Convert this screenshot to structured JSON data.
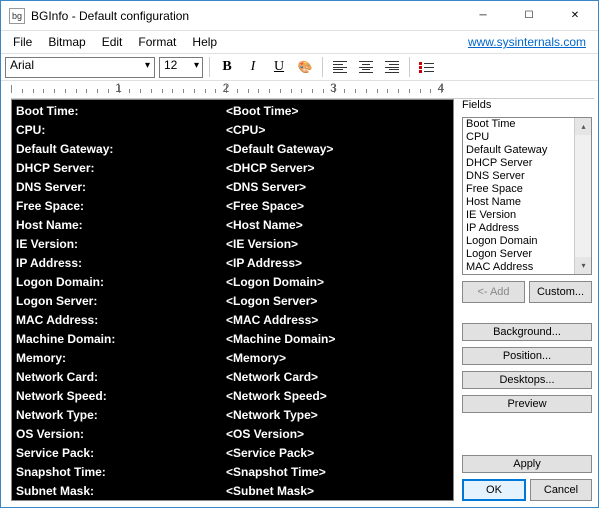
{
  "window": {
    "title": "BGInfo - Default configuration",
    "icon_label": "bg"
  },
  "link": "www.sysinternals.com",
  "menu": [
    "File",
    "Bitmap",
    "Edit",
    "Format",
    "Help"
  ],
  "toolbar": {
    "font": "Arial",
    "size": "12"
  },
  "ruler_labels": [
    "1",
    "2",
    "3",
    "4"
  ],
  "editor_rows": [
    {
      "label": "Boot Time:",
      "value": "<Boot Time>"
    },
    {
      "label": "CPU:",
      "value": "<CPU>"
    },
    {
      "label": "Default Gateway:",
      "value": "<Default Gateway>"
    },
    {
      "label": "DHCP Server:",
      "value": "<DHCP Server>"
    },
    {
      "label": "DNS Server:",
      "value": "<DNS Server>"
    },
    {
      "label": "Free Space:",
      "value": "<Free Space>"
    },
    {
      "label": "Host Name:",
      "value": "<Host Name>"
    },
    {
      "label": "IE Version:",
      "value": "<IE Version>"
    },
    {
      "label": "IP Address:",
      "value": "<IP Address>"
    },
    {
      "label": "Logon Domain:",
      "value": "<Logon Domain>"
    },
    {
      "label": "Logon Server:",
      "value": "<Logon Server>"
    },
    {
      "label": "MAC Address:",
      "value": "<MAC Address>"
    },
    {
      "label": "Machine Domain:",
      "value": "<Machine Domain>"
    },
    {
      "label": "Memory:",
      "value": "<Memory>"
    },
    {
      "label": "Network Card:",
      "value": "<Network Card>"
    },
    {
      "label": "Network Speed:",
      "value": "<Network Speed>"
    },
    {
      "label": "Network Type:",
      "value": "<Network Type>"
    },
    {
      "label": "OS Version:",
      "value": "<OS Version>"
    },
    {
      "label": "Service Pack:",
      "value": "<Service Pack>"
    },
    {
      "label": "Snapshot Time:",
      "value": "<Snapshot Time>"
    },
    {
      "label": "Subnet Mask:",
      "value": "<Subnet Mask>"
    }
  ],
  "fields": {
    "label": "Fields",
    "items": [
      "Boot Time",
      "CPU",
      "Default Gateway",
      "DHCP Server",
      "DNS Server",
      "Free Space",
      "Host Name",
      "IE Version",
      "IP Address",
      "Logon Domain",
      "Logon Server",
      "MAC Address"
    ]
  },
  "buttons": {
    "add": "<- Add",
    "custom": "Custom...",
    "background": "Background...",
    "position": "Position...",
    "desktops": "Desktops...",
    "preview": "Preview",
    "apply": "Apply",
    "ok": "OK",
    "cancel": "Cancel"
  }
}
